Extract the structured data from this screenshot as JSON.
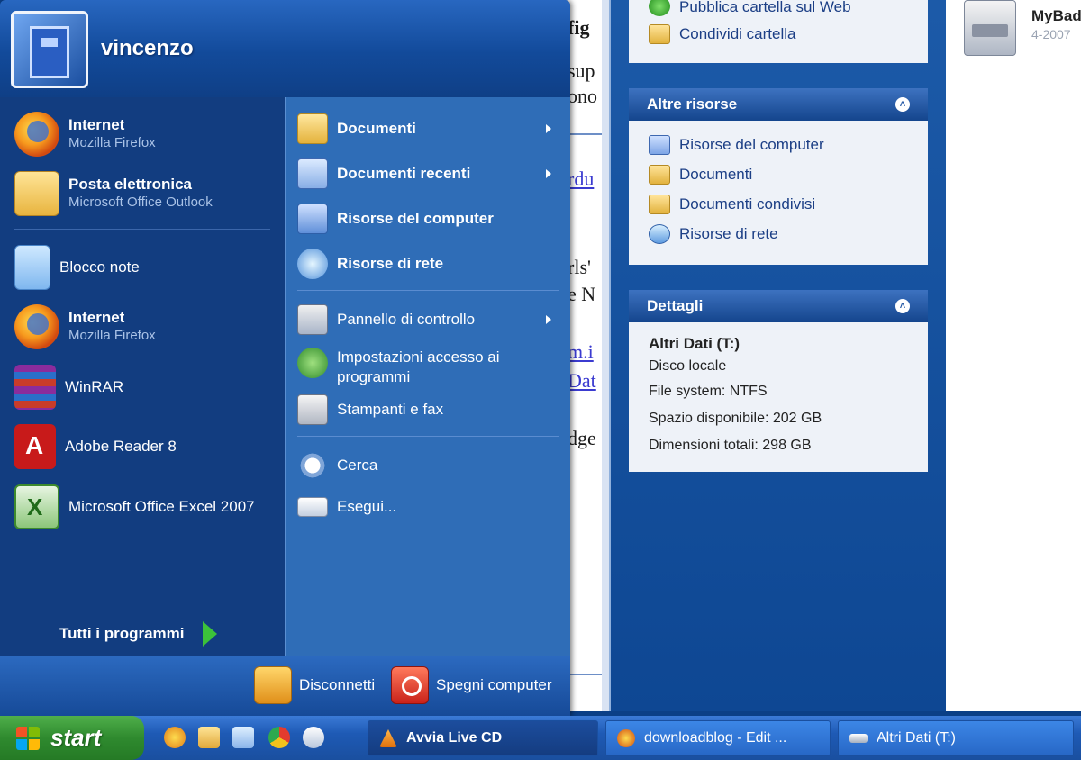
{
  "background": {
    "doc_fragments": [
      "fig",
      "sup",
      "ono",
      "rdu",
      "rls'",
      "e N",
      "m.i",
      "Dat",
      "dge"
    ],
    "task_pane": {
      "top_links": [
        "Pubblica cartella sul Web",
        "Condividi cartella"
      ],
      "other_resources": {
        "title": "Altre risorse",
        "links": [
          "Risorse del computer",
          "Documenti",
          "Documenti condivisi",
          "Risorse di rete"
        ]
      },
      "details": {
        "title": "Dettagli",
        "name": "Altri Dati (T:)",
        "type": "Disco locale",
        "filesystem": "File system: NTFS",
        "free_space": "Spazio disponibile: 202 GB",
        "total_size": "Dimensioni totali: 298 GB"
      },
      "collapse_glyph": "˄"
    },
    "drive": {
      "name": "MyBad",
      "sub": "4-2007"
    }
  },
  "start_menu": {
    "user_name": "vincenzo",
    "pinned": [
      {
        "title": "Internet",
        "subtitle": "Mozilla Firefox",
        "icon": "firefox-icon"
      },
      {
        "title": "Posta elettronica",
        "subtitle": "Microsoft Office Outlook",
        "icon": "outlook-icon"
      }
    ],
    "recent": [
      {
        "label": "Blocco note",
        "icon": "notepad-icon"
      },
      {
        "title": "Internet",
        "subtitle": "Mozilla Firefox",
        "icon": "firefox-icon"
      },
      {
        "label": "WinRAR",
        "icon": "winrar-icon"
      },
      {
        "label": "Adobe Reader 8",
        "icon": "adobe-reader-icon"
      },
      {
        "label": "Microsoft Office Excel 2007",
        "icon": "excel-icon"
      }
    ],
    "all_programs": "Tutti i programmi",
    "places": [
      {
        "label": "Documenti",
        "icon": "documents-folder-icon",
        "bold": true,
        "submenu": true
      },
      {
        "label": "Documenti recenti",
        "icon": "recent-documents-icon",
        "bold": true,
        "submenu": true
      },
      {
        "label": "Risorse del computer",
        "icon": "my-computer-icon",
        "bold": true,
        "submenu": false
      },
      {
        "label": "Risorse di rete",
        "icon": "network-icon",
        "bold": true,
        "submenu": false
      },
      {
        "label": "Pannello di controllo",
        "icon": "control-panel-icon",
        "bold": false,
        "submenu": true
      },
      {
        "label": "Impostazioni accesso ai programmi",
        "icon": "program-access-icon",
        "bold": false,
        "submenu": false
      },
      {
        "label": "Stampanti e fax",
        "icon": "printer-icon",
        "bold": false,
        "submenu": false
      },
      {
        "label": "Cerca",
        "icon": "search-icon",
        "bold": false,
        "submenu": false
      },
      {
        "label": "Esegui...",
        "icon": "run-icon",
        "bold": false,
        "submenu": false
      }
    ],
    "footer": {
      "logoff": "Disconnetti",
      "shutdown": "Spegni computer"
    }
  },
  "taskbar": {
    "start_label": "start",
    "quick_launch": [
      "firefox-icon",
      "outlook-icon",
      "show-desktop-icon",
      "chrome-icon",
      "messenger-icon"
    ],
    "tasks": [
      {
        "label": "Avvia Live CD",
        "icon": "vlc-icon",
        "active": true
      },
      {
        "label": "downloadblog - Edit ...",
        "icon": "firefox-icon",
        "active": false
      },
      {
        "label": "Altri Dati (T:)",
        "icon": "drive-icon",
        "active": false
      }
    ]
  },
  "colors": {
    "menu_left": "#123d80",
    "menu_right": "#2f6db7",
    "start_green": "#2f8a2f",
    "taskbar_blue": "#1e5ab5"
  }
}
